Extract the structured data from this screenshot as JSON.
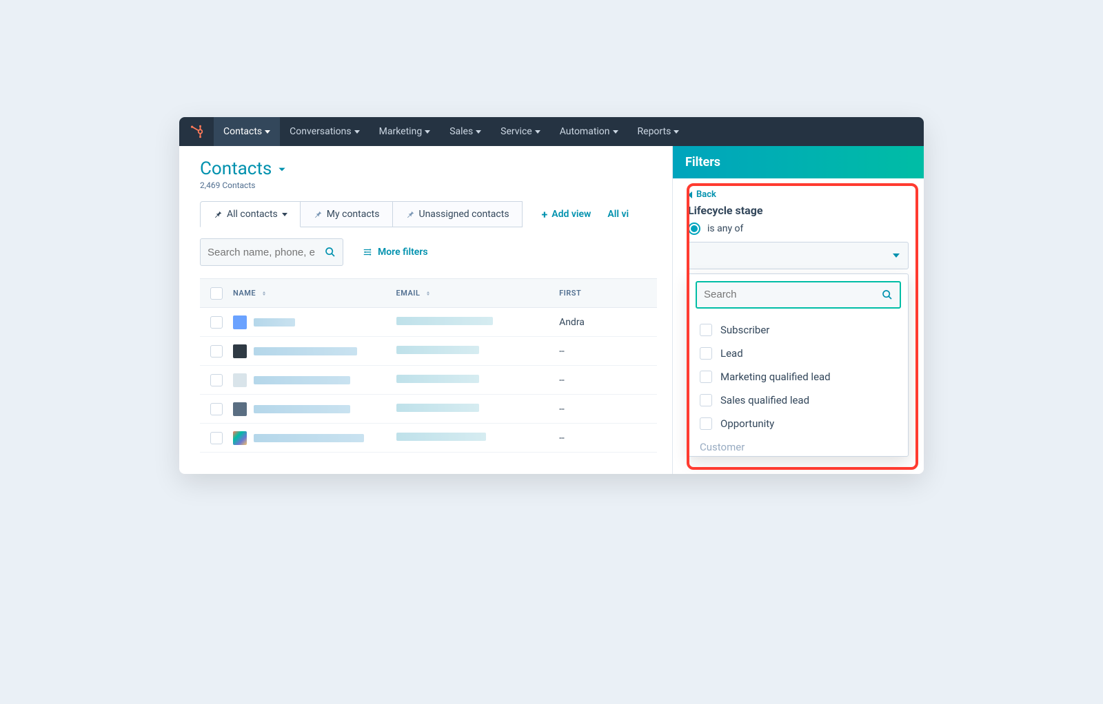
{
  "nav": {
    "items": [
      {
        "label": "Contacts",
        "active": true
      },
      {
        "label": "Conversations"
      },
      {
        "label": "Marketing"
      },
      {
        "label": "Sales"
      },
      {
        "label": "Service"
      },
      {
        "label": "Automation"
      },
      {
        "label": "Reports"
      }
    ]
  },
  "page": {
    "title": "Contacts",
    "subtitle": "2,469 Contacts"
  },
  "views": {
    "tabs": [
      {
        "label": "All contacts",
        "hasCaret": true,
        "active": true
      },
      {
        "label": "My contacts"
      },
      {
        "label": "Unassigned contacts"
      }
    ],
    "add_view_label": "Add view",
    "all_views_label": "All vi"
  },
  "toolbar": {
    "search_placeholder": "Search name, phone, e",
    "more_filters_label": "More filters"
  },
  "table": {
    "columns": {
      "name": "NAME",
      "email": "EMAIL",
      "first": "FIRST"
    },
    "rows": [
      {
        "avatar": "#6aa2ff",
        "first": "Andra"
      },
      {
        "avatar": "#2f3a44",
        "first": "--"
      },
      {
        "avatar": "#d9e4ea",
        "first": "--"
      },
      {
        "avatar": "#5a6e82",
        "first": "--"
      },
      {
        "avatar_gradient": true,
        "first": "--"
      }
    ]
  },
  "filters": {
    "panel_title": "Filters",
    "back_label": "Back",
    "title": "Lifecycle stage",
    "radio_label": "is any of",
    "dropdown": {
      "search_placeholder": "Search",
      "options": [
        "Subscriber",
        "Lead",
        "Marketing qualified lead",
        "Sales qualified lead",
        "Opportunity"
      ],
      "truncated_next": "Customer"
    }
  }
}
